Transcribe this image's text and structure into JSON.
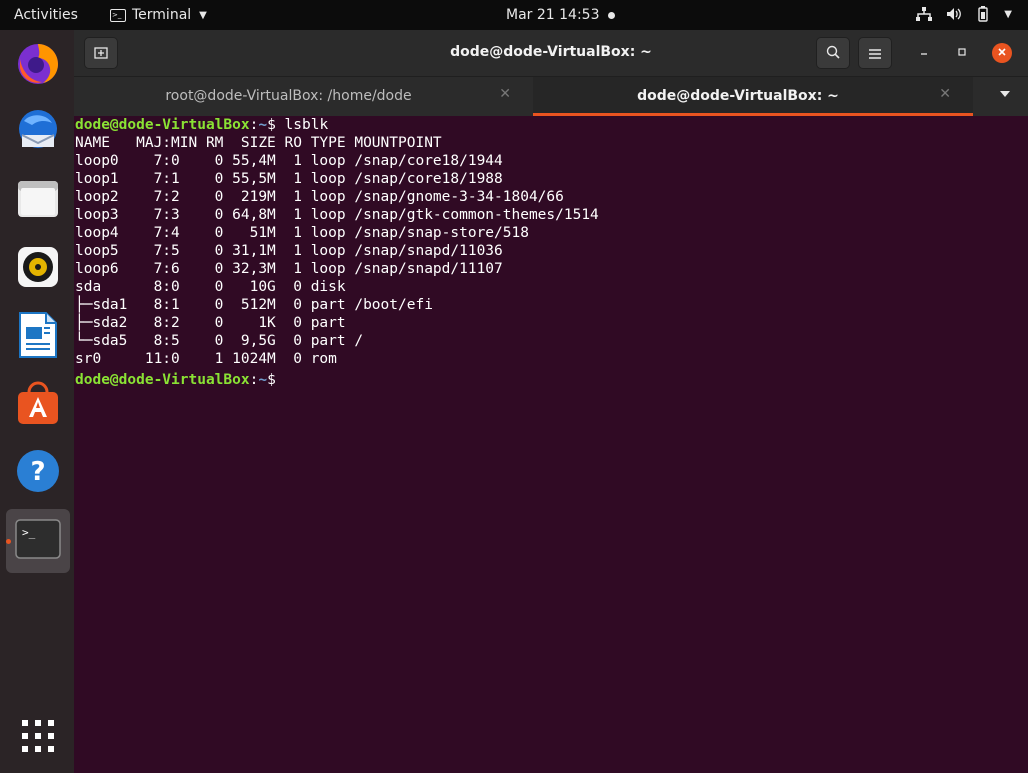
{
  "topbar": {
    "activities": "Activities",
    "app_name": "Terminal",
    "clock": "Mar 21  14:53"
  },
  "dock": {
    "items": [
      {
        "name": "firefox-icon"
      },
      {
        "name": "thunderbird-icon"
      },
      {
        "name": "files-icon"
      },
      {
        "name": "rhythmbox-icon"
      },
      {
        "name": "libreoffice-writer-icon"
      },
      {
        "name": "ubuntu-software-icon"
      },
      {
        "name": "help-icon"
      },
      {
        "name": "terminal-icon"
      },
      {
        "name": "show-applications-icon"
      }
    ]
  },
  "window": {
    "title": "dode@dode-VirtualBox: ~",
    "tabs": [
      {
        "label": "root@dode-VirtualBox: /home/dode",
        "active": false
      },
      {
        "label": "dode@dode-VirtualBox: ~",
        "active": true
      }
    ]
  },
  "terminal": {
    "prompt1": {
      "host": "dode@dode-VirtualBox",
      "colon": ":",
      "path": "~",
      "dollar": "$ ",
      "command": "lsblk"
    },
    "output": [
      "NAME   MAJ:MIN RM  SIZE RO TYPE MOUNTPOINT",
      "loop0    7:0    0 55,4M  1 loop /snap/core18/1944",
      "loop1    7:1    0 55,5M  1 loop /snap/core18/1988",
      "loop2    7:2    0  219M  1 loop /snap/gnome-3-34-1804/66",
      "loop3    7:3    0 64,8M  1 loop /snap/gtk-common-themes/1514",
      "loop4    7:4    0   51M  1 loop /snap/snap-store/518",
      "loop5    7:5    0 31,1M  1 loop /snap/snapd/11036",
      "loop6    7:6    0 32,3M  1 loop /snap/snapd/11107",
      "sda      8:0    0   10G  0 disk ",
      "├─sda1   8:1    0  512M  0 part /boot/efi",
      "├─sda2   8:2    0    1K  0 part ",
      "└─sda5   8:5    0  9,5G  0 part /",
      "sr0     11:0    1 1024M  0 rom  "
    ],
    "prompt2": {
      "host": "dode@dode-VirtualBox",
      "colon": ":",
      "path": "~",
      "dollar": "$ "
    }
  }
}
